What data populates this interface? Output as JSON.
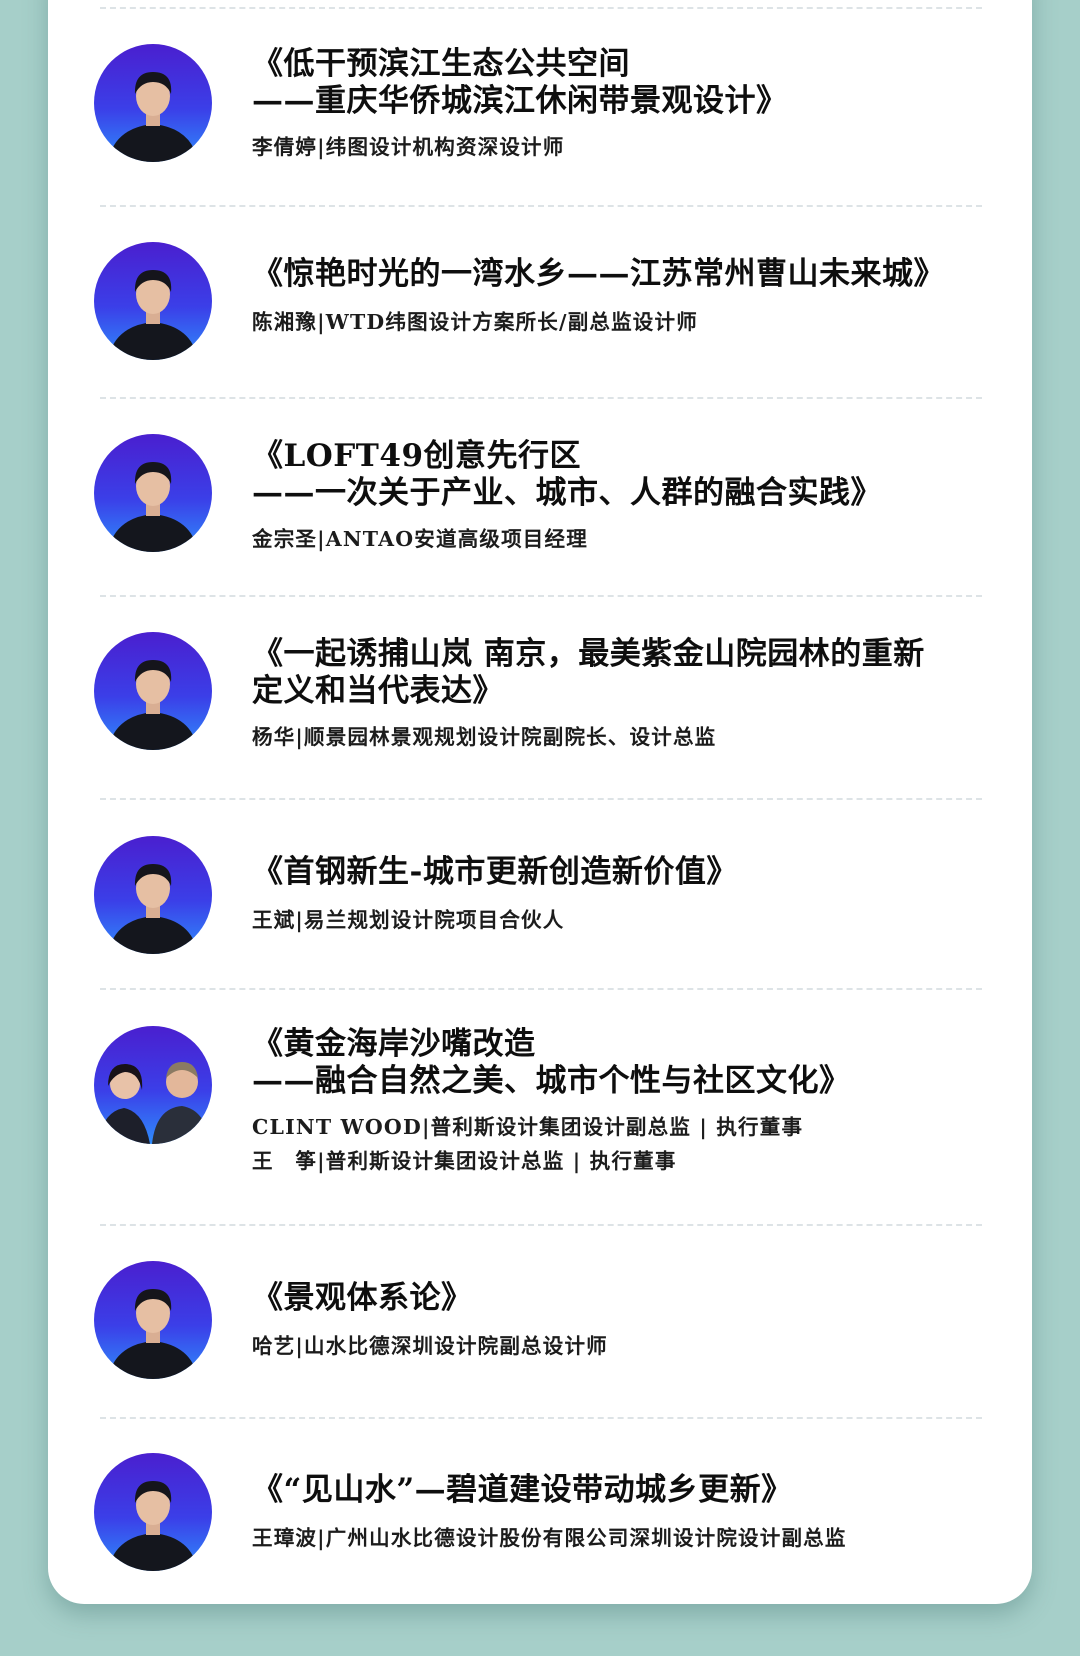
{
  "colors": {
    "page_background": "#a6cfc9",
    "card_background": "#ffffff",
    "avatar_gradient_top": "#4a1fcf",
    "avatar_gradient_bottom": "#2f7dfa",
    "divider": "#dde3e6",
    "text": "#111111"
  },
  "talks": [
    {
      "title_lines": [
        "《低干预滨江生态公共空间",
        "——重庆华侨城滨江休闲带景观设计》"
      ],
      "speakers": [
        "李倩婷|纬图设计机构资深设计师"
      ],
      "avatar_icon": "speaker-portrait-icon"
    },
    {
      "title_lines": [
        "《惊艳时光的一湾水乡——江苏常州曹山未来城》"
      ],
      "speakers": [
        "陈湘豫|WTD纬图设计方案所长/副总监设计师"
      ],
      "avatar_icon": "speaker-portrait-icon"
    },
    {
      "title_lines": [
        "《LOFT49创意先行区",
        "——一次关于产业、城市、人群的融合实践》"
      ],
      "speakers": [
        "金宗圣|ANTAO安道高级项目经理"
      ],
      "avatar_icon": "speaker-portrait-icon"
    },
    {
      "title_lines": [
        "《一起诱捕山岚 南京，最美紫金山院园林的重新",
        "定义和当代表达》"
      ],
      "speakers": [
        "杨华|顺景园林景观规划设计院副院长、设计总监"
      ],
      "avatar_icon": "speaker-portrait-icon"
    },
    {
      "title_lines": [
        "《首钢新生-城市更新创造新价值》"
      ],
      "speakers": [
        "王斌|易兰规划设计院项目合伙人"
      ],
      "avatar_icon": "speaker-portrait-icon"
    },
    {
      "title_lines": [
        "《黄金海岸沙嘴改造",
        "——融合自然之美、城市个性与社区文化》"
      ],
      "speakers": [
        "CLINT WOOD|普利斯设计集团设计副总监 | 执行董事",
        "王　筝|普利斯设计集团设计总监 | 执行董事"
      ],
      "avatar_icon": "two-speakers-portrait-icon"
    },
    {
      "title_lines": [
        "《景观体系论》"
      ],
      "speakers": [
        "哈艺|山水比德深圳设计院副总设计师"
      ],
      "avatar_icon": "speaker-portrait-icon"
    },
    {
      "title_lines": [
        "《“见山水”—碧道建设带动城乡更新》"
      ],
      "speakers": [
        "王璋波|广州山水比德设计股份有限公司深圳设计院设计副总监"
      ],
      "avatar_icon": "speaker-portrait-icon"
    }
  ]
}
